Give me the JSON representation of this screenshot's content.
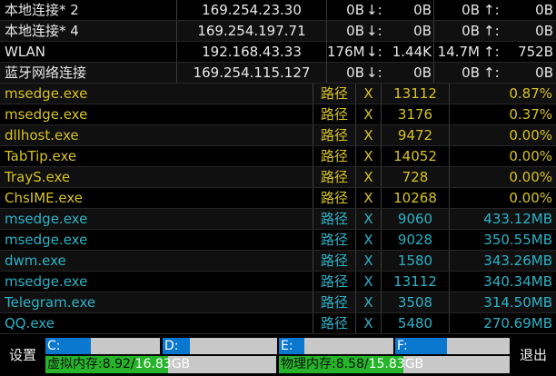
{
  "net": [
    {
      "name": "本地连接* 2",
      "ip": "169.254.23.30",
      "total": "0B",
      "down": "0B",
      "up_total": "0B",
      "up": "0B"
    },
    {
      "name": "本地连接* 4",
      "ip": "169.254.197.71",
      "total": "0B",
      "down": "0B",
      "up_total": "0B",
      "up": "0B"
    },
    {
      "name": "WLAN",
      "ip": "192.168.43.33",
      "total": "176M",
      "down": "1.44K",
      "up_total": "14.7M",
      "up": "752B"
    },
    {
      "name": "蓝牙网络连接",
      "ip": "169.254.115.127",
      "total": "0B",
      "down": "0B",
      "up_total": "0B",
      "up": "0B"
    }
  ],
  "arrows": {
    "down": "↓:",
    "up": "↑:"
  },
  "cpu_procs": [
    {
      "name": "msedge.exe",
      "path": "路径",
      "kill": "X",
      "pid": "13112",
      "value": "0.87%"
    },
    {
      "name": "msedge.exe",
      "path": "路径",
      "kill": "X",
      "pid": "3176",
      "value": "0.37%"
    },
    {
      "name": "dllhost.exe",
      "path": "路径",
      "kill": "X",
      "pid": "9472",
      "value": "0.00%"
    },
    {
      "name": "TabTip.exe",
      "path": "路径",
      "kill": "X",
      "pid": "14052",
      "value": "0.00%"
    },
    {
      "name": "TrayS.exe",
      "path": "路径",
      "kill": "X",
      "pid": "728",
      "value": "0.00%"
    },
    {
      "name": "ChsIME.exe",
      "path": "路径",
      "kill": "X",
      "pid": "10268",
      "value": "0.00%"
    }
  ],
  "mem_procs": [
    {
      "name": "msedge.exe",
      "path": "路径",
      "kill": "X",
      "pid": "9060",
      "value": "433.12MB"
    },
    {
      "name": "msedge.exe",
      "path": "路径",
      "kill": "X",
      "pid": "9028",
      "value": "350.55MB"
    },
    {
      "name": "dwm.exe",
      "path": "路径",
      "kill": "X",
      "pid": "1580",
      "value": "343.26MB"
    },
    {
      "name": "msedge.exe",
      "path": "路径",
      "kill": "X",
      "pid": "13112",
      "value": "340.34MB"
    },
    {
      "name": "Telegram.exe",
      "path": "路径",
      "kill": "X",
      "pid": "3508",
      "value": "314.50MB"
    },
    {
      "name": "QQ.exe",
      "path": "路径",
      "kill": "X",
      "pid": "5480",
      "value": "270.69MB"
    }
  ],
  "settings_label": "设置",
  "exit_label": "退出",
  "disks": [
    {
      "label": "C:",
      "used_fraction": 0.4
    },
    {
      "label": "D:",
      "used_fraction": 0.24
    },
    {
      "label": "E:",
      "used_fraction": 0.22
    },
    {
      "label": "F:",
      "used_fraction": 0.45
    }
  ],
  "virtual_mem": {
    "used_label": "虚拟内存:8.92/",
    "total_label": "16.83GB",
    "used_fraction": 0.53
  },
  "physical_mem": {
    "used_label": "物理内存:8.58/",
    "total_label": "15.83GB",
    "used_fraction": 0.54
  },
  "colors": {
    "cpu_text": "#d7c321",
    "mem_text": "#2bb3c7",
    "disk_fill": "#0b78d0",
    "mem_fill": "#26b52a"
  }
}
